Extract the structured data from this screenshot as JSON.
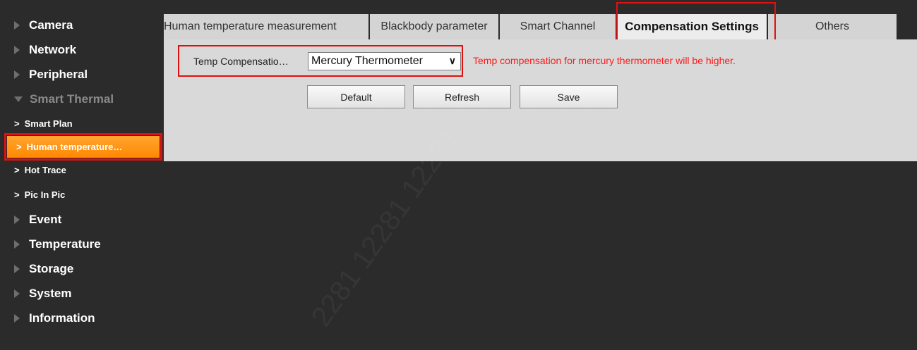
{
  "sidebar": {
    "items": [
      {
        "label": "Camera"
      },
      {
        "label": "Network"
      },
      {
        "label": "Peripheral"
      },
      {
        "label": "Smart Thermal"
      },
      {
        "label": "Event"
      },
      {
        "label": "Temperature"
      },
      {
        "label": "Storage"
      },
      {
        "label": "System"
      },
      {
        "label": "Information"
      }
    ],
    "subitems": [
      {
        "label": "Smart Plan"
      },
      {
        "label": "Human temperature…"
      },
      {
        "label": "Hot Trace"
      },
      {
        "label": "Pic In Pic"
      }
    ],
    "chevron": ">"
  },
  "tabs": [
    {
      "label": "Human temperature measurement"
    },
    {
      "label": "Blackbody parameter"
    },
    {
      "label": "Smart Channel"
    },
    {
      "label": "Compensation Settings"
    },
    {
      "label": "Others"
    }
  ],
  "form": {
    "label": "Temp Compensatio…",
    "select_value": "Mercury Thermometer",
    "hint": "Temp compensation for mercury thermometer will be higher."
  },
  "buttons": {
    "default": "Default",
    "refresh": "Refresh",
    "save": "Save"
  },
  "watermark": "2281 12281 12281",
  "colors": {
    "accent_orange": "#ff9a1f",
    "highlight_red": "#e01010",
    "hint_red": "#ff1a1a",
    "sidebar_bg": "#2b2b2b",
    "panel_bg": "#d9d9d9"
  }
}
